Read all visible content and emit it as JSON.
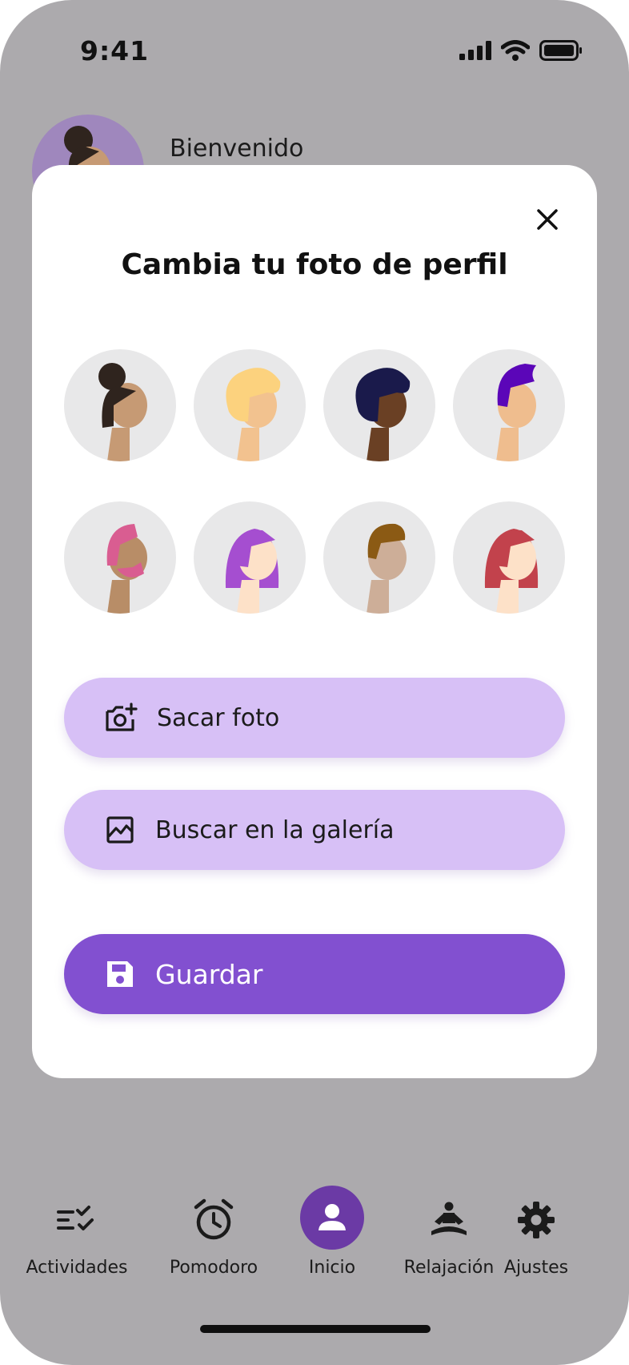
{
  "status": {
    "time": "9:41"
  },
  "home": {
    "welcome": "Bienvenido"
  },
  "modal": {
    "title": "Cambia tu foto de perfil",
    "avatars": [
      {
        "name": "avatar-option-1",
        "skin": "#c69a74",
        "hair": "#2f241e"
      },
      {
        "name": "avatar-option-2",
        "skin": "#f2c28f",
        "hair": "#fcd27e"
      },
      {
        "name": "avatar-option-3",
        "skin": "#6a4024",
        "hair": "#1a1a4b"
      },
      {
        "name": "avatar-option-4",
        "skin": "#efbd8e",
        "hair": "#5b06b8"
      },
      {
        "name": "avatar-option-5",
        "skin": "#b88d67",
        "hair": "#d95d91"
      },
      {
        "name": "avatar-option-6",
        "skin": "#fde1c8",
        "hair": "#a54ed0"
      },
      {
        "name": "avatar-option-7",
        "skin": "#cdae98",
        "hair": "#8b5a14"
      },
      {
        "name": "avatar-option-8",
        "skin": "#fde1c8",
        "hair": "#c2424c"
      }
    ],
    "take_photo_label": "Sacar foto",
    "gallery_label": "Buscar en la galería",
    "save_label": "Guardar"
  },
  "nav": {
    "items": [
      {
        "label": "Actividades",
        "icon": "activities-check-icon"
      },
      {
        "label": "Pomodoro",
        "icon": "alarm-clock-icon"
      },
      {
        "label": "Inicio",
        "icon": "user-icon"
      },
      {
        "label": "Relajación",
        "icon": "meditation-icon"
      },
      {
        "label": "Ajustes",
        "icon": "gear-icon"
      }
    ]
  },
  "colors": {
    "accent": "#8250d0",
    "button_light": "#d7c0f6",
    "nav_active": "#6b3aa5",
    "overlay": "#acaaad"
  }
}
